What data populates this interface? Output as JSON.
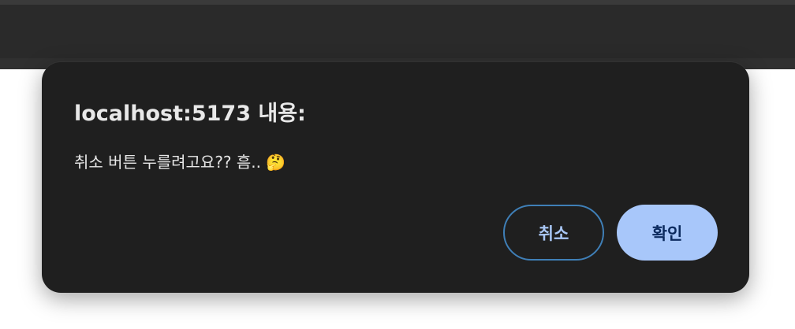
{
  "dialog": {
    "title": "localhost:5173 내용:",
    "message": "취소 버튼 누를려고요?? 흠.. 🤔",
    "cancel_label": "취소",
    "ok_label": "확인"
  },
  "colors": {
    "dialog_background": "#1f1f1f",
    "ok_button": "#a8c7fa",
    "cancel_border": "#3f7fb7"
  }
}
